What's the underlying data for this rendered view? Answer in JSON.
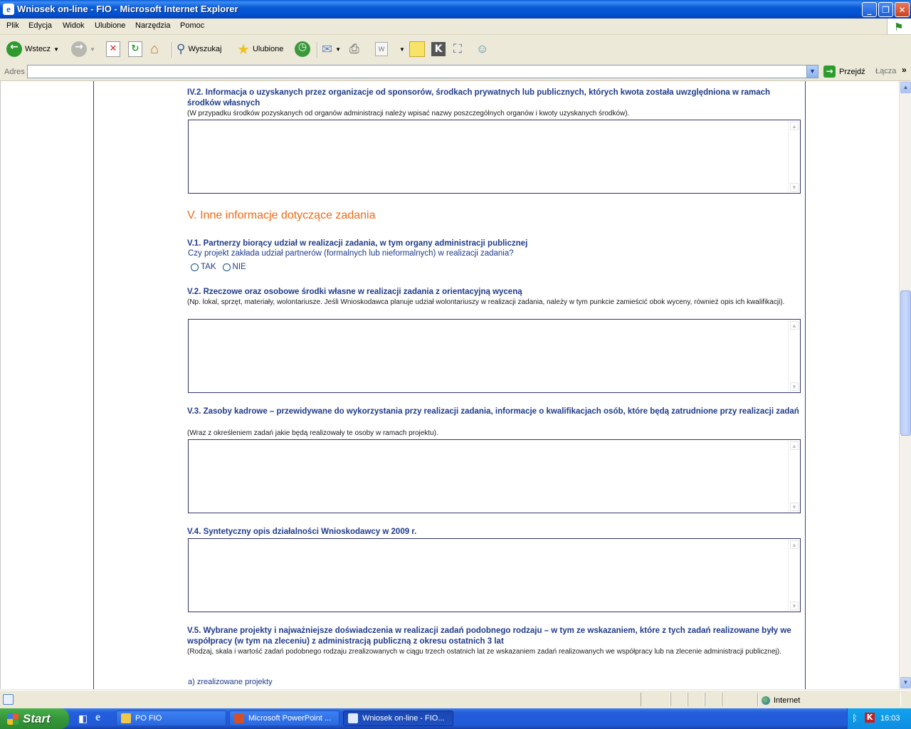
{
  "window": {
    "title": "Wniosek on-line - FIO - Microsoft Internet Explorer",
    "minimize": "_",
    "maximize": "❐",
    "close": "✕"
  },
  "menu": [
    "Plik",
    "Edycja",
    "Widok",
    "Ulubione",
    "Narzędzia",
    "Pomoc"
  ],
  "toolbar": {
    "back_label": "Wstecz",
    "search_label": "Wyszukaj",
    "favorites_label": "Ulubione"
  },
  "address": {
    "label": "Adres",
    "value": "",
    "go_label": "Przejdź",
    "links_label": "Łącza"
  },
  "form": {
    "iv2": {
      "heading": "IV.2. Informacja o uzyskanych przez organizacje od sponsorów, środkach prywatnych lub publicznych, których kwota została uwzględniona w ramach środków własnych",
      "note": "(W przypadku środków pozyskanych od organów administracji należy wpisać nazwy poszczególnych organów i kwoty uzyskanych środków)."
    },
    "section5": {
      "title": "V. Inne informacje dotyczące zadania"
    },
    "v1": {
      "heading": "V.1. Partnerzy biorący udział w realizacji zadania, w tym organy administracji publicznej",
      "question": "Czy projekt zakłada udział partnerów (formalnych lub nieformalnych) w realizacji zadania?",
      "opt_yes": "TAK",
      "opt_no": "NIE",
      "selected": ""
    },
    "v2": {
      "heading": "V.2. Rzeczowe oraz osobowe środki własne w realizacji zadania z orientacyjną wyceną",
      "note": "(Np. lokal, sprzęt, materiały, wolontariusze. Jeśli Wnioskodawca planuje udział wolontariuszy w realizacji zadania, należy w tym punkcie zamieścić obok wyceny, również opis ich kwalifikacji)."
    },
    "v3": {
      "heading": "V.3. Zasoby kadrowe – przewidywane do wykorzystania przy realizacji zadania, informacje o kwalifikacjach osób, które będą zatrudnione przy realizacji zadań",
      "note": "(Wraz z określeniem zadań jakie będą realizowały te osoby w ramach projektu)."
    },
    "v4": {
      "heading": "V.4. Syntetyczny opis działalności Wnioskodawcy w 2009 r."
    },
    "v5": {
      "heading": "V.5. Wybrane projekty i najważniejsze doświadczenia w realizacji zadań podobnego rodzaju – w tym ze wskazaniem, które z tych zadań realizowane były we współpracy (w tym na zleceniu) z administracją publiczną z okresu ostatnich 3 lat",
      "note": "(Rodzaj, skala i wartość zadań podobnego rodzaju zrealizowanych w ciągu trzech ostatnich lat ze wskazaniem zadań realizowanych we współpracy lub na zlecenie administracji publicznej).",
      "sub_a": "a) zrealizowane projekty"
    }
  },
  "scroll": {
    "position_fraction": 0.45
  },
  "status": {
    "text": "",
    "zone": "Internet"
  },
  "taskbar": {
    "start_label": "Start",
    "buttons": [
      {
        "label": "PO FIO",
        "active": false
      },
      {
        "label": "Microsoft PowerPoint ...",
        "active": false
      },
      {
        "label": "Wniosek on-line - FIO...",
        "active": true
      }
    ],
    "clock": "16:03"
  }
}
